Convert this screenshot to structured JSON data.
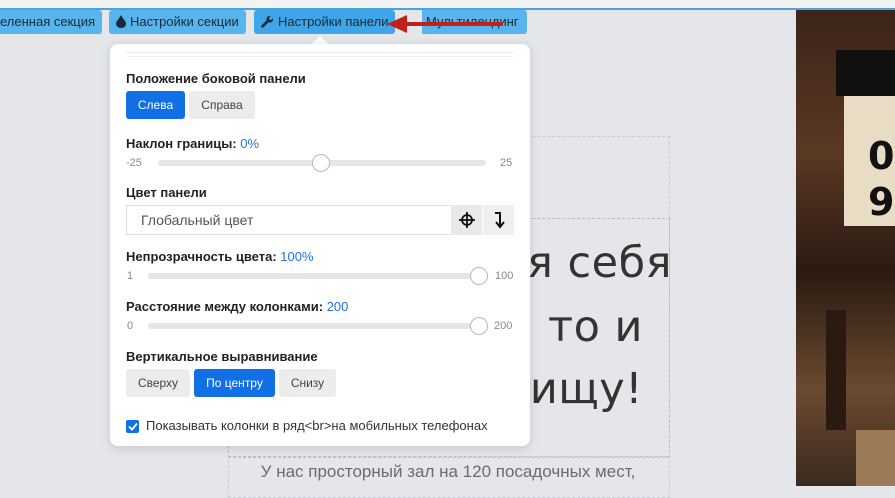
{
  "tabs": {
    "selected_section": "еленная секция",
    "section_settings": "Настройки секции",
    "panel_settings": "Настройки панели",
    "multilanding": "Мультилендинг"
  },
  "canvas": {
    "hero_lines": [
      "ля себя",
      "то и",
      "ищу!"
    ],
    "subtitle": "У нас просторный зал на 120 посадочных мест,"
  },
  "panel": {
    "position": {
      "label": "Положение боковой панели",
      "options": [
        "Слева",
        "Справа"
      ],
      "selected": "Слева"
    },
    "border_tilt": {
      "label": "Наклон границы:",
      "value_text": "0%",
      "min": "-25",
      "max": "25",
      "value": 0
    },
    "panel_color": {
      "label": "Цвет панели",
      "value": "Глобальный цвет"
    },
    "opacity": {
      "label": "Непрозрачность цвета:",
      "value_text": "100%",
      "min": "1",
      "max": "100",
      "value": 100
    },
    "column_gap": {
      "label": "Расстояние между колонками:",
      "value_text": "200",
      "min": "0",
      "max": "200",
      "value": 200
    },
    "vertical_align": {
      "label": "Вертикальное выравнивание",
      "options": [
        "Сверху",
        "По центру",
        "Снизу"
      ],
      "selected": "По центру"
    },
    "mobile_columns": {
      "label": "Показывать колонки в ряд<br>на мобильных телефонах",
      "checked": true
    }
  },
  "colors": {
    "accent": "#1170e6",
    "tab_bg": "#58b4ec",
    "annotation_arrow": "#c0221b"
  }
}
